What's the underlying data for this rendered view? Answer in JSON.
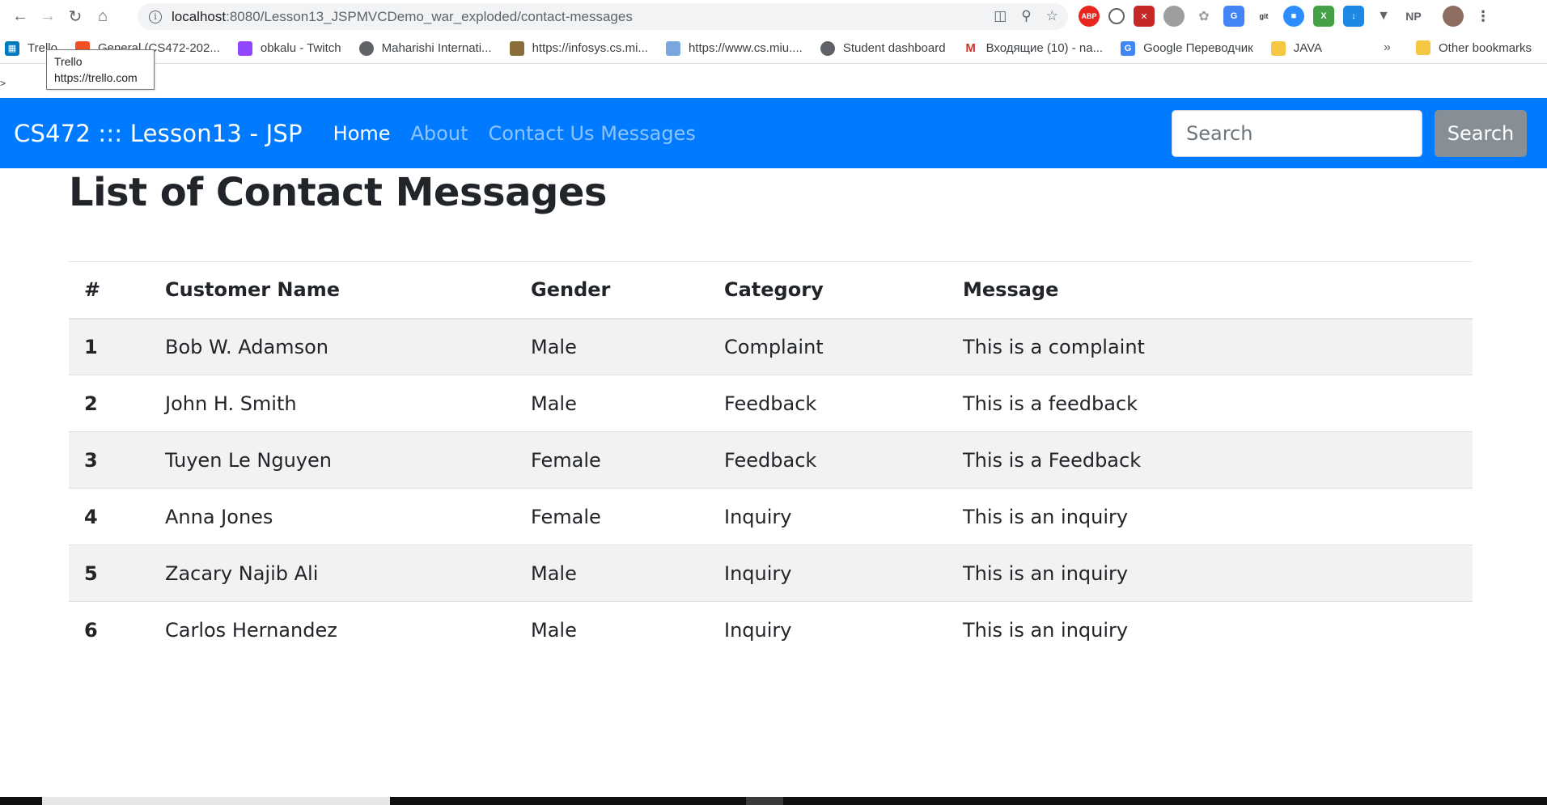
{
  "browser": {
    "url_host": "localhost",
    "url_path": ":8080/Lesson13_JSPMVCDemo_war_exploded/contact-messages",
    "bookmarks": [
      {
        "label": "Trello",
        "color": "#0079bf",
        "icon": "trello-icon"
      },
      {
        "label": "General (CS472-202...",
        "color": "#f25022",
        "icon": "teams-icon"
      },
      {
        "label": "obkalu - Twitch",
        "color": "#9146ff",
        "icon": "twitch-icon"
      },
      {
        "label": "Maharishi Internati...",
        "color": "#5f6368",
        "icon": "globe-icon"
      },
      {
        "label": "https://infosys.cs.mi...",
        "color": "#8a6d3b",
        "icon": "page-icon"
      },
      {
        "label": "https://www.cs.miu....",
        "color": "#7aa7e0",
        "icon": "page-icon"
      },
      {
        "label": "Student dashboard",
        "color": "#5f6368",
        "icon": "globe-icon"
      },
      {
        "label": "Входящие (10) - na...",
        "color": "#d93025",
        "icon": "gmail-icon"
      },
      {
        "label": "Google Переводчик",
        "color": "#4285f4",
        "icon": "translate-icon"
      },
      {
        "label": "JAVA",
        "color": "#f4c842",
        "icon": "folder-icon"
      }
    ],
    "more_label": "»",
    "other_bookmarks": "Other bookmarks",
    "tooltip_title": "Trello",
    "tooltip_url": "https://trello.com",
    "extensions": [
      "ABP",
      "NP"
    ]
  },
  "navbar": {
    "brand": "CS472 ::: Lesson13 - JSP",
    "links": [
      {
        "label": "Home",
        "active": true
      },
      {
        "label": "About",
        "active": false
      },
      {
        "label": "Contact Us Messages",
        "active": false
      }
    ],
    "search_placeholder": "Search",
    "search_button": "Search",
    "bg_color": "#007bff"
  },
  "main": {
    "title": "List of Contact Messages",
    "columns": [
      "#",
      "Customer Name",
      "Gender",
      "Category",
      "Message"
    ],
    "rows": [
      {
        "idx": "1",
        "name": "Bob W. Adamson",
        "gender": "Male",
        "category": "Complaint",
        "message": "This is a complaint"
      },
      {
        "idx": "2",
        "name": "John H. Smith",
        "gender": "Male",
        "category": "Feedback",
        "message": "This is a feedback"
      },
      {
        "idx": "3",
        "name": "Tuyen Le Nguyen",
        "gender": "Female",
        "category": "Feedback",
        "message": "This is a Feedback"
      },
      {
        "idx": "4",
        "name": "Anna Jones",
        "gender": "Female",
        "category": "Inquiry",
        "message": "This is an inquiry"
      },
      {
        "idx": "5",
        "name": "Zacary Najib Ali",
        "gender": "Male",
        "category": "Inquiry",
        "message": "This is an inquiry"
      },
      {
        "idx": "6",
        "name": "Carlos Hernandez",
        "gender": "Male",
        "category": "Inquiry",
        "message": "This is an inquiry"
      }
    ]
  }
}
